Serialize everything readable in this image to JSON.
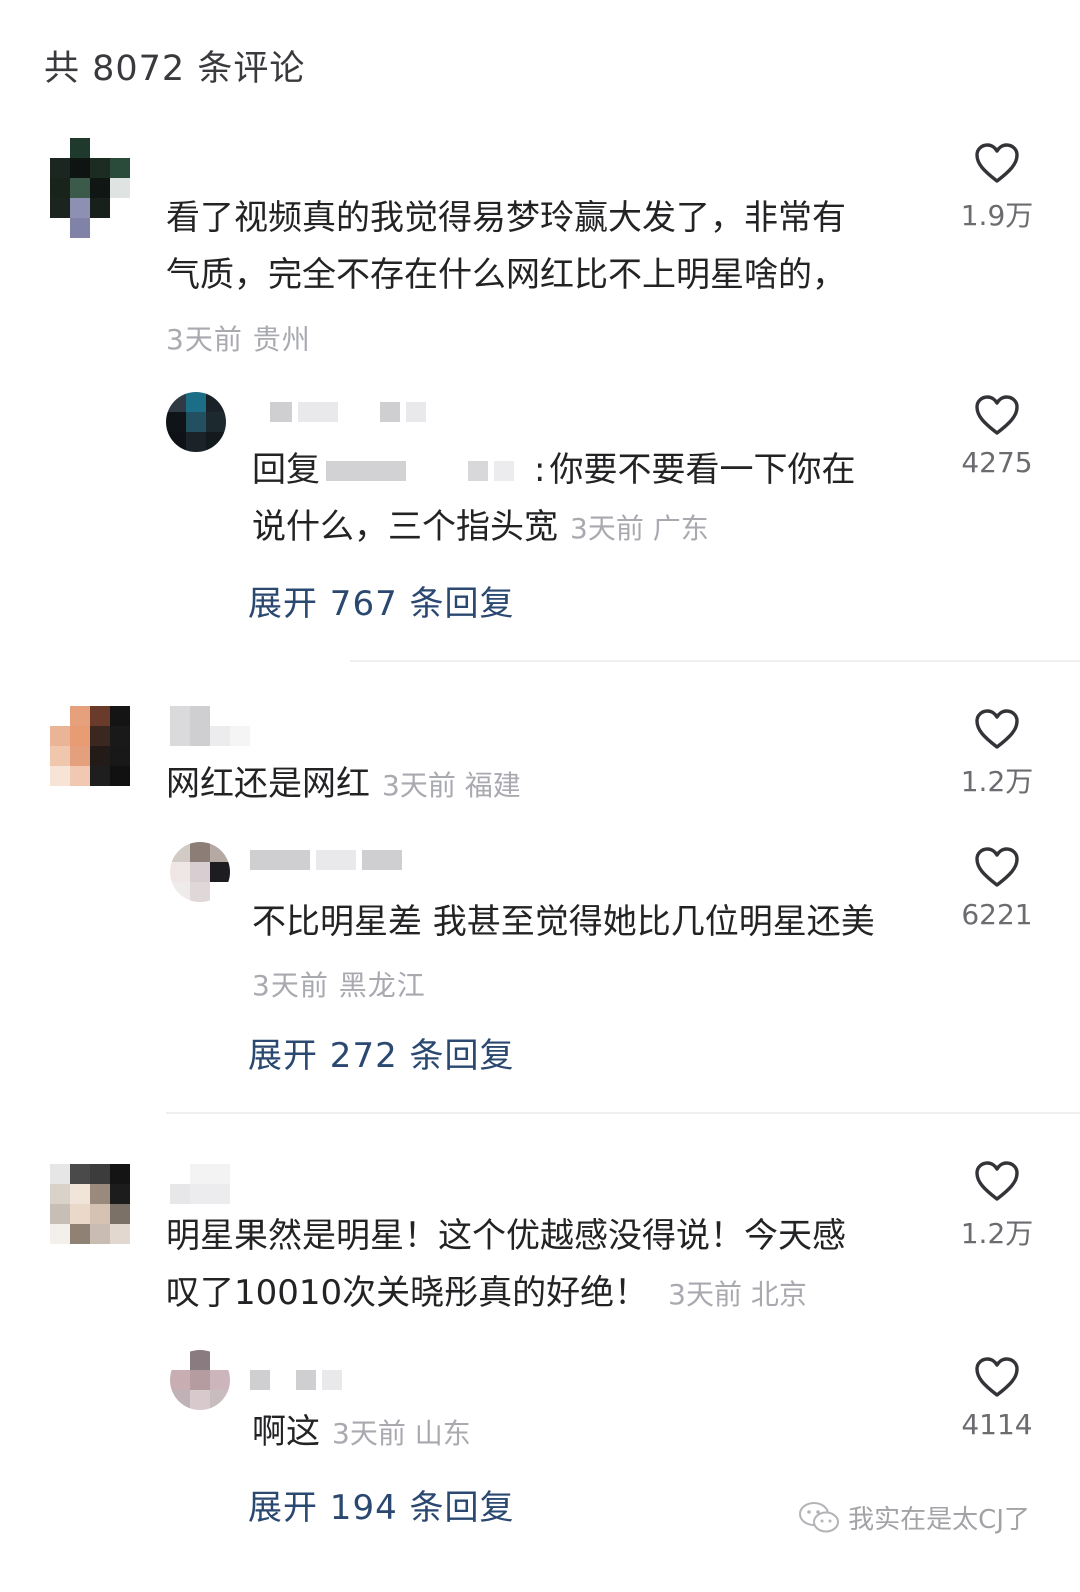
{
  "header": {
    "title": "共 8072 条评论"
  },
  "comments": [
    {
      "text": "看了视频真的我觉得易梦玲赢大发了，非常有气质，完全不存在什么网红比不上明星啥的，",
      "text_line1": "看了视频真的我觉得易梦玲赢大发了，非常有",
      "text_line2": "气质，完全不存在什么网红比不上明星啥的，",
      "meta": "3天前 贵州",
      "likes": "1.9万",
      "reply": {
        "prefix": "回复",
        "separator": ":",
        "text_line1": "你要不要看一下你在",
        "text_line2": "说什么，三个指头宽",
        "meta": "3天前 广东",
        "likes": "4275"
      },
      "expand": "展开 767 条回复"
    },
    {
      "text": "网红还是网红",
      "meta": "3天前 福建",
      "likes": "1.2万",
      "reply": {
        "text": "不比明星差 我甚至觉得她比几位明星还美",
        "meta": "3天前 黑龙江",
        "likes": "6221"
      },
      "expand": "展开 272 条回复"
    },
    {
      "text_line1": "明星果然是明星！这个优越感没得说！今天感",
      "text_line2": "叹了10010次关晓彤真的好绝！",
      "meta": "3天前 北京",
      "likes": "1.2万",
      "reply": {
        "text": "啊这",
        "meta": "3天前 山东",
        "likes": "4114"
      },
      "expand": "展开 194 条回复"
    }
  ],
  "watermark": {
    "text": "我实在是太CJ了"
  },
  "icons": {
    "like": "heart-outline-icon",
    "watermark": "wechat-icon"
  }
}
